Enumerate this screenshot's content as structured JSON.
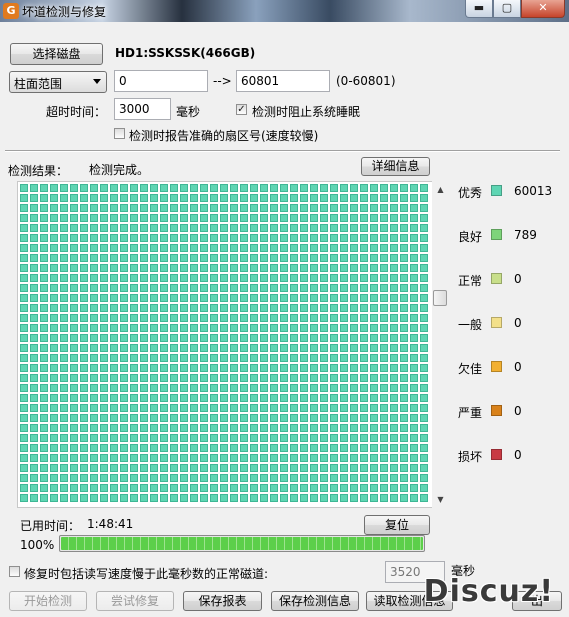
{
  "window": {
    "title": "坏道检测与修复",
    "app_icon_glyph": "G",
    "buttons": {
      "minimize": "▬",
      "maximize": "▢",
      "close": "✕"
    }
  },
  "disk": {
    "select_button": "选择磁盘",
    "name": "HD1:SSKSSK(466GB)"
  },
  "range": {
    "mode": "柱面范围",
    "start": "0",
    "arrow": "-->",
    "end": "60801",
    "hint": "(0-60801)"
  },
  "timeout": {
    "label": "超时时间：",
    "value": "3000",
    "unit": "毫秒"
  },
  "options": {
    "prevent_sleep": {
      "label": "检测时阻止系统睡眠",
      "checked": true
    },
    "report_sector": {
      "label": "检测时报告准确的扇区号(速度较慢)",
      "checked": false
    }
  },
  "result": {
    "label": "检测结果：",
    "status": "检测完成。",
    "detail_button": "详细信息"
  },
  "legend": [
    {
      "label": "优秀",
      "color": "#5ed5b3",
      "count": "60013"
    },
    {
      "label": "良好",
      "color": "#7ed47a",
      "count": "789"
    },
    {
      "label": "正常",
      "color": "#c8df8a",
      "count": "0"
    },
    {
      "label": "一般",
      "color": "#f3e08a",
      "count": "0"
    },
    {
      "label": "欠佳",
      "color": "#f2b032",
      "count": "0"
    },
    {
      "label": "严重",
      "color": "#d9821a",
      "count": "0"
    },
    {
      "label": "损坏",
      "color": "#c83a44",
      "count": "0"
    }
  ],
  "elapsed": {
    "label": "已用时间：",
    "value": "1:48:41",
    "reset_button": "复位"
  },
  "progress": {
    "percent_text": "100%",
    "fraction": 1.0
  },
  "repair_option": {
    "label": "修复时包括读写速度慢于此毫秒数的正常磁道:",
    "checked": false,
    "value": "3520",
    "unit": "毫秒"
  },
  "actions": {
    "start": "开始检测",
    "try_repair": "尝试修复",
    "save_report": "保存报表",
    "save_info": "保存检测信息",
    "load_info": "读取检测信息",
    "last": "出"
  },
  "watermark": "Discuz!",
  "scrollbar": {
    "up": "▲",
    "down": "▼"
  }
}
